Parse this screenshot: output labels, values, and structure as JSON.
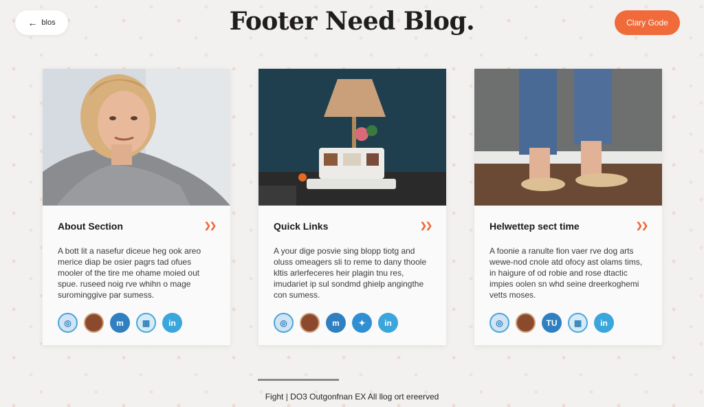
{
  "header": {
    "back_label": "blos",
    "title": "Footer Need Blog.",
    "cta_label": "Clary Gode"
  },
  "cards": [
    {
      "heading": "About Section",
      "text": "A bott lit a nasefur diceue heg ook areo merice diap be osier pagrs tad ofues mooler of the tire me ohame moied out spue. ruseed noig rve whihn o mage surominggive par sumess.",
      "socials": [
        "globe-icon",
        "photo-icon",
        "m-icon",
        "grid-icon",
        "linkedin-icon"
      ],
      "social_labels": [
        "◎",
        "",
        "m",
        "▦",
        "in"
      ]
    },
    {
      "heading": "Quick Links",
      "text": "A your dige posvie sing blopp tiotg and oluss omeagers sli to reme to dany thoole kltis arlerfeceres heir plagin tnu res, imudariet ip sul sondmd ghielp angingthe con sumess.",
      "socials": [
        "globe-icon",
        "photo-icon",
        "m-icon",
        "bird-icon",
        "linkedin-icon"
      ],
      "social_labels": [
        "◎",
        "",
        "m",
        "✦",
        "in"
      ]
    },
    {
      "heading": "Helwettep sect time",
      "text": "A foonie a ranulte fion vaer rve dog arts wewe-nod cnole atd ofocy ast olams tims, in haigure of od robie and rose dtactic impies oolen sn whd seine dreerkoghemi vetts moses.",
      "socials": [
        "globe-icon",
        "photo-icon",
        "m-icon",
        "grid-icon",
        "linkedin-icon"
      ],
      "social_labels": [
        "◎",
        "",
        "TU",
        "▦",
        "in"
      ]
    }
  ],
  "footer": {
    "text": "Fight | DO3 Outgonfnan EX All llog ort ereerved"
  },
  "colors": {
    "accent": "#f06a3a",
    "background": "#f3f1ef",
    "card": "#fafafa"
  }
}
